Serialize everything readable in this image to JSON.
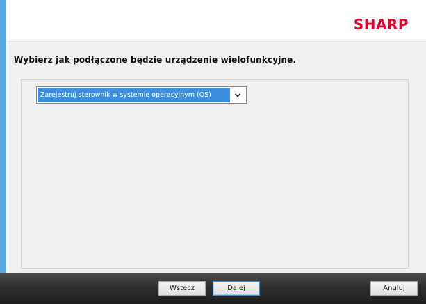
{
  "header": {
    "brand": "SHARP",
    "brand_color": "#e4002b"
  },
  "main": {
    "instruction": "Wybierz jak podłączone będzie urządzenie wielofunkcyjne.",
    "connection_select": {
      "selected_value": "Zarejestruj sterownik w systemie operacyjnym (OS)",
      "arrow_icon": "chevron-down-icon"
    }
  },
  "footer": {
    "back_button": {
      "mnemonic": "W",
      "rest": "stecz",
      "label": "Wstecz"
    },
    "next_button": {
      "mnemonic": "D",
      "rest": "alej",
      "label": "Dalej"
    },
    "cancel_button": {
      "label": "Anuluj"
    }
  },
  "colors": {
    "accent_frame": "#59a9e2",
    "selection_highlight": "#3d8ee0",
    "footer_bar": "#2f2f2f"
  }
}
